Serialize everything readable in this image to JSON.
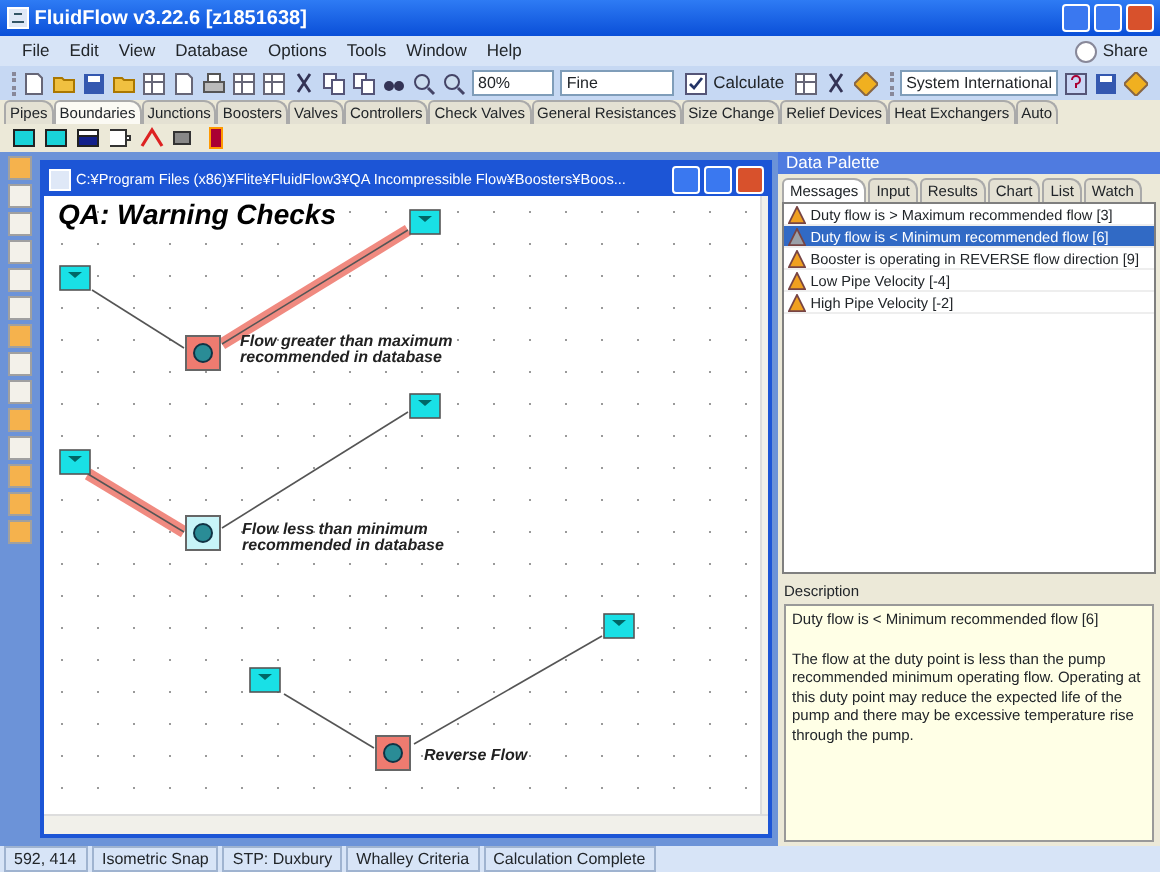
{
  "window": {
    "title": "FluidFlow v3.22.6 [z1851638]"
  },
  "menu": [
    "File",
    "Edit",
    "View",
    "Database",
    "Options",
    "Tools",
    "Window",
    "Help"
  ],
  "share": "Share",
  "toolbar": {
    "zoom": "80%",
    "mesh": "Fine",
    "calculate": "Calculate",
    "units": "System International"
  },
  "component_tabs": [
    {
      "label": "Pipes",
      "selected": false
    },
    {
      "label": "Boundaries",
      "selected": true
    },
    {
      "label": "Junctions",
      "selected": false
    },
    {
      "label": "Boosters",
      "selected": false
    },
    {
      "label": "Valves",
      "selected": false
    },
    {
      "label": "Controllers",
      "selected": false
    },
    {
      "label": "Check Valves",
      "selected": false
    },
    {
      "label": "General Resistances",
      "selected": false
    },
    {
      "label": "Size Change",
      "selected": false
    },
    {
      "label": "Relief Devices",
      "selected": false
    },
    {
      "label": "Heat Exchangers",
      "selected": false
    },
    {
      "label": "Auto",
      "selected": false
    }
  ],
  "document": {
    "title": "C:¥Program Files (x86)¥Flite¥FluidFlow3¥QA Incompressible Flow¥Boosters¥Boos...",
    "heading": "QA: Warning Checks",
    "annotations": [
      {
        "lines": [
          "Flow greater than maximum",
          "recommended in database"
        ]
      },
      {
        "lines": [
          "Flow less than minimum",
          "recommended in database"
        ]
      },
      {
        "lines": [
          "Reverse Flow"
        ]
      }
    ],
    "pumps": [
      {
        "warning": true
      },
      {
        "warning": false
      },
      {
        "warning": true
      }
    ],
    "pipes": [
      {
        "highlighted": false
      },
      {
        "highlighted": true
      },
      {
        "highlighted": true
      },
      {
        "highlighted": false
      },
      {
        "highlighted": false
      },
      {
        "highlighted": false
      }
    ]
  },
  "data_palette": {
    "title": "Data Palette",
    "tabs": [
      {
        "label": "Messages",
        "selected": true
      },
      {
        "label": "Input",
        "selected": false
      },
      {
        "label": "Results",
        "selected": false
      },
      {
        "label": "Chart",
        "selected": false
      },
      {
        "label": "List",
        "selected": false
      },
      {
        "label": "Watch",
        "selected": false
      }
    ],
    "messages": [
      {
        "text": "Duty flow is > Maximum recommended flow [3]",
        "selected": false
      },
      {
        "text": "Duty flow is < Minimum recommended flow  [6]",
        "selected": true
      },
      {
        "text": "Booster is operating in REVERSE flow direction [9]",
        "selected": false
      },
      {
        "text": "Low Pipe Velocity [-4]",
        "selected": false
      },
      {
        "text": "High Pipe Velocity [-2]",
        "selected": false
      }
    ],
    "description_label": "Description",
    "description_title": "Duty flow is < Minimum recommended flow  [6]",
    "description_body": "The flow at the duty point is less than the pump recommended minimum operating flow. Operating at this duty point may reduce the expected life of the pump and there may be excessive temperature rise through the pump."
  },
  "status_bar": [
    "592, 414",
    "Isometric Snap",
    "STP: Duxbury",
    "Whalley Criteria",
    "Calculation Complete"
  ]
}
